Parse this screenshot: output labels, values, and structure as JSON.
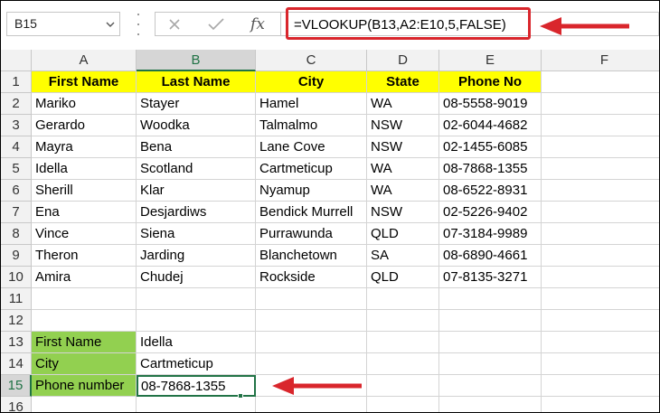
{
  "formula_bar": {
    "name_box": "B15",
    "cancel_icon": "close-icon",
    "enter_icon": "check-icon",
    "function_label": "fx",
    "formula": "=VLOOKUP(B13,A2:E10,5,FALSE)"
  },
  "colors": {
    "highlight_yellow": "#ffff00",
    "label_green": "#92d050",
    "annotation_red": "#d9262c",
    "excel_green": "#217346"
  },
  "columns": [
    "A",
    "B",
    "C",
    "D",
    "E",
    "F"
  ],
  "rows": [
    "1",
    "2",
    "3",
    "4",
    "5",
    "6",
    "7",
    "8",
    "9",
    "10",
    "11",
    "12",
    "13",
    "14",
    "15",
    "16"
  ],
  "table": {
    "headers": [
      "First Name",
      "Last Name",
      "City",
      "State",
      "Phone No"
    ],
    "data": [
      [
        "Mariko",
        "Stayer",
        "Hamel",
        "WA",
        "08-5558-9019"
      ],
      [
        "Gerardo",
        "Woodka",
        "Talmalmo",
        "NSW",
        "02-6044-4682"
      ],
      [
        "Mayra",
        "Bena",
        "Lane Cove",
        "NSW",
        "02-1455-6085"
      ],
      [
        "Idella",
        "Scotland",
        "Cartmeticup",
        "WA",
        "08-7868-1355"
      ],
      [
        "Sherill",
        "Klar",
        "Nyamup",
        "WA",
        "08-6522-8931"
      ],
      [
        "Ena",
        "Desjardiws",
        "Bendick Murrell",
        "NSW",
        "02-5226-9402"
      ],
      [
        "Vince",
        "Siena",
        "Purrawunda",
        "QLD",
        "07-3184-9989"
      ],
      [
        "Theron",
        "Jarding",
        "Blanchetown",
        "SA",
        "08-6890-4661"
      ],
      [
        "Amira",
        "Chudej",
        "Rockside",
        "QLD",
        "07-8135-3271"
      ]
    ]
  },
  "lookup": {
    "label_1": "First Name",
    "value_1": "Idella",
    "label_2": "City",
    "value_2": "Cartmeticup",
    "label_3": "Phone number",
    "value_3": "08-7868-1355"
  }
}
